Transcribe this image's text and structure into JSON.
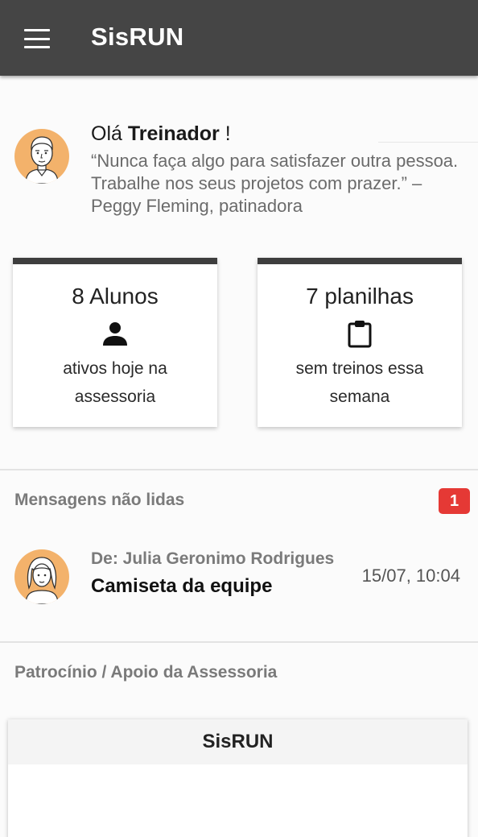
{
  "appbar": {
    "title": "SisRUN"
  },
  "greeting": {
    "hello": "Olá",
    "name": "Treinador",
    "suffix": " !",
    "quote": "“Nunca faça algo para satisfazer outra pessoa. Trabalhe nos seus projetos com prazer.” – Peggy Fleming, patinadora"
  },
  "stats": [
    {
      "number": "8 Alunos",
      "icon": "person-icon",
      "caption_line1": "ativos hoje na",
      "caption_line2": "assessoria"
    },
    {
      "number": "7 planilhas",
      "icon": "clipboard-icon",
      "caption_line1": "sem treinos essa",
      "caption_line2": "semana"
    }
  ],
  "messages": {
    "section_title": "Mensagens não lidas",
    "unread_count": "1",
    "items": [
      {
        "from": "De: Julia Geronimo Rodrigues",
        "subject": "Camiseta da equipe",
        "time": "15/07, 10:04"
      }
    ]
  },
  "sponsor": {
    "section_title": "Patrocínio / Apoio da Assessoria",
    "card_title": "SisRUN"
  },
  "colors": {
    "appbar": "#454545",
    "badge": "#e53935",
    "avatar_bg": "#f3b26b"
  }
}
